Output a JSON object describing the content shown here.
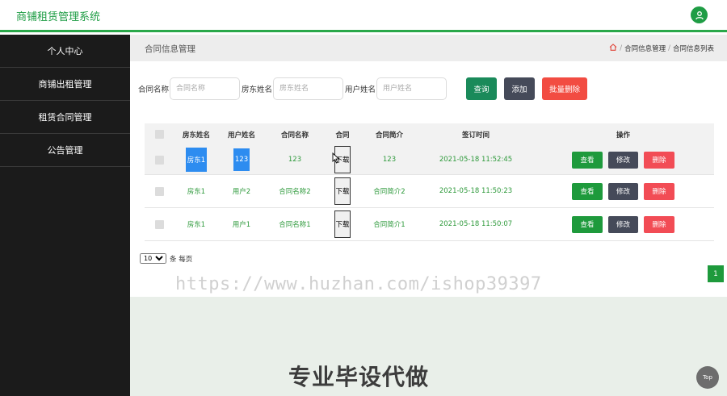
{
  "app": {
    "title": "商铺租赁管理系统",
    "user_icon": "user-icon",
    "accent": "#1f9d45"
  },
  "sidebar": {
    "items": [
      {
        "label": "个人中心"
      },
      {
        "label": "商铺出租管理"
      },
      {
        "label": "租赁合同管理"
      },
      {
        "label": "公告管理"
      }
    ]
  },
  "breadcrumb": {
    "page_title": "合同信息管理",
    "home_icon": "home-icon",
    "sep": "/",
    "level1": "合同信息管理",
    "level2": "合同信息列表"
  },
  "search": {
    "fields": [
      {
        "label": "合同名称",
        "placeholder": "合同名称"
      },
      {
        "label": "房东姓名",
        "placeholder": "房东姓名"
      },
      {
        "label": "用户姓名",
        "placeholder": "用户姓名"
      }
    ],
    "query_label": "查询",
    "add_label": "添加",
    "batch_delete_label": "批量删除"
  },
  "table": {
    "headers": [
      "房东姓名",
      "用户姓名",
      "合同名称",
      "合同",
      "合同简介",
      "签订时间",
      "操作"
    ],
    "rows": [
      {
        "landlord": "房东1",
        "user": "123",
        "name": "123",
        "file": "下载",
        "intro": "123",
        "time": "2021-05-18 11:52:45"
      },
      {
        "landlord": "房东1",
        "user": "用户2",
        "name": "合同名称2",
        "file": "下载",
        "intro": "合同简介2",
        "time": "2021-05-18 11:50:23"
      },
      {
        "landlord": "房东1",
        "user": "用户1",
        "name": "合同名称1",
        "file": "下载",
        "intro": "合同简介1",
        "time": "2021-05-18 11:50:07"
      }
    ],
    "actions": {
      "view": "查看",
      "edit": "修改",
      "delete": "删除"
    }
  },
  "pagination": {
    "page_size": "10",
    "per_page_text": "条 每页",
    "current_page": "1"
  },
  "watermark": {
    "url": "https://www.huzhan.com/ishop39397",
    "slogan": "专业毕设代做"
  },
  "back_to_top": "Top"
}
